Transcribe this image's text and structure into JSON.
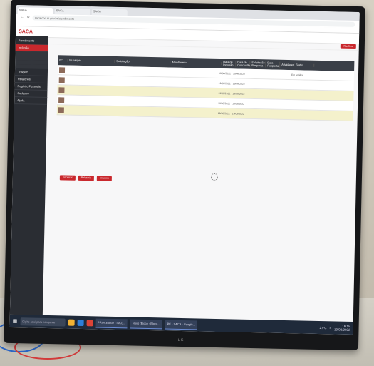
{
  "browser": {
    "tabs": [
      "SACA",
      "SACA",
      "SACA"
    ],
    "url": "saca.cpd.rs.gov.br/atendimento"
  },
  "app": {
    "logo": "SACA",
    "buttons": {
      "filter": "Atualizar",
      "action1": "Encerrar",
      "action2": "Relatório",
      "action3": "Imprimir"
    }
  },
  "sidebar": {
    "items": [
      "Atendimento",
      "Inclusão",
      "Triagem",
      "Relatórios",
      "Registro Pessoais",
      "Cadastro",
      "Ajuda"
    ]
  },
  "table": {
    "headers": [
      "Nº",
      "Município",
      "Solicitação",
      "Atendimento",
      "Data de Inclusão",
      "Data de Conclusão",
      "Solicitação Resposta",
      "Data Resposta",
      "Atividades",
      "Status"
    ],
    "rows": [
      {
        "date1": "19/08/2022",
        "date2": "19/08/2022",
        "status": "Em análise"
      },
      {
        "date1": "19/08/2022",
        "date2": "19/08/2022",
        "status": ""
      },
      {
        "date1": "19/08/2022",
        "date2": "19/08/2022",
        "status": ""
      },
      {
        "date1": "19/08/2022",
        "date2": "19/08/2022",
        "status": ""
      },
      {
        "date1": "19/08/2022",
        "date2": "19/08/2022",
        "status": ""
      }
    ]
  },
  "taskbar": {
    "search": "Digite aqui para pesquisar",
    "items": [
      "PROCESSO - INCL...",
      "Novo (Bloco - Bloco...",
      "PE - SACA - Google..."
    ],
    "weather": "27°C",
    "time": "16:18",
    "date": "19/08/2022"
  },
  "monitor_brand": "LG"
}
